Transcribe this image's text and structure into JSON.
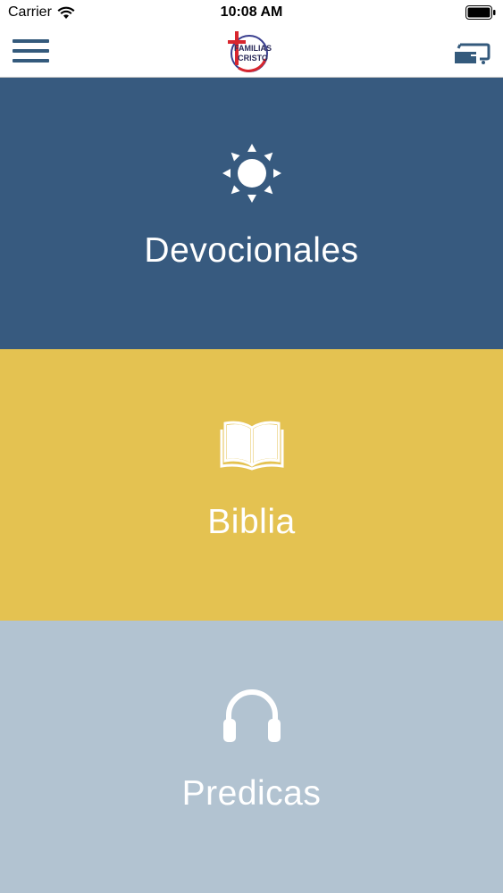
{
  "status_bar": {
    "carrier": "Carrier",
    "time": "10:08 AM"
  },
  "nav": {
    "logo_line1": "FAMILIAS",
    "logo_line2": "CRISTO",
    "menu_icon": "hamburger-menu-icon",
    "cast_icon": "cast-icon"
  },
  "tiles": [
    {
      "label": "Devocionales",
      "icon": "sun-icon",
      "color": "#375a7f"
    },
    {
      "label": "Biblia",
      "icon": "open-book-icon",
      "color": "#e4c251"
    },
    {
      "label": "Predicas",
      "icon": "headphones-icon",
      "color": "#b2c3d1"
    }
  ],
  "colors": {
    "accent": "#345a7c",
    "tile_text": "#ffffff",
    "logo_cross": "#d8262e"
  }
}
